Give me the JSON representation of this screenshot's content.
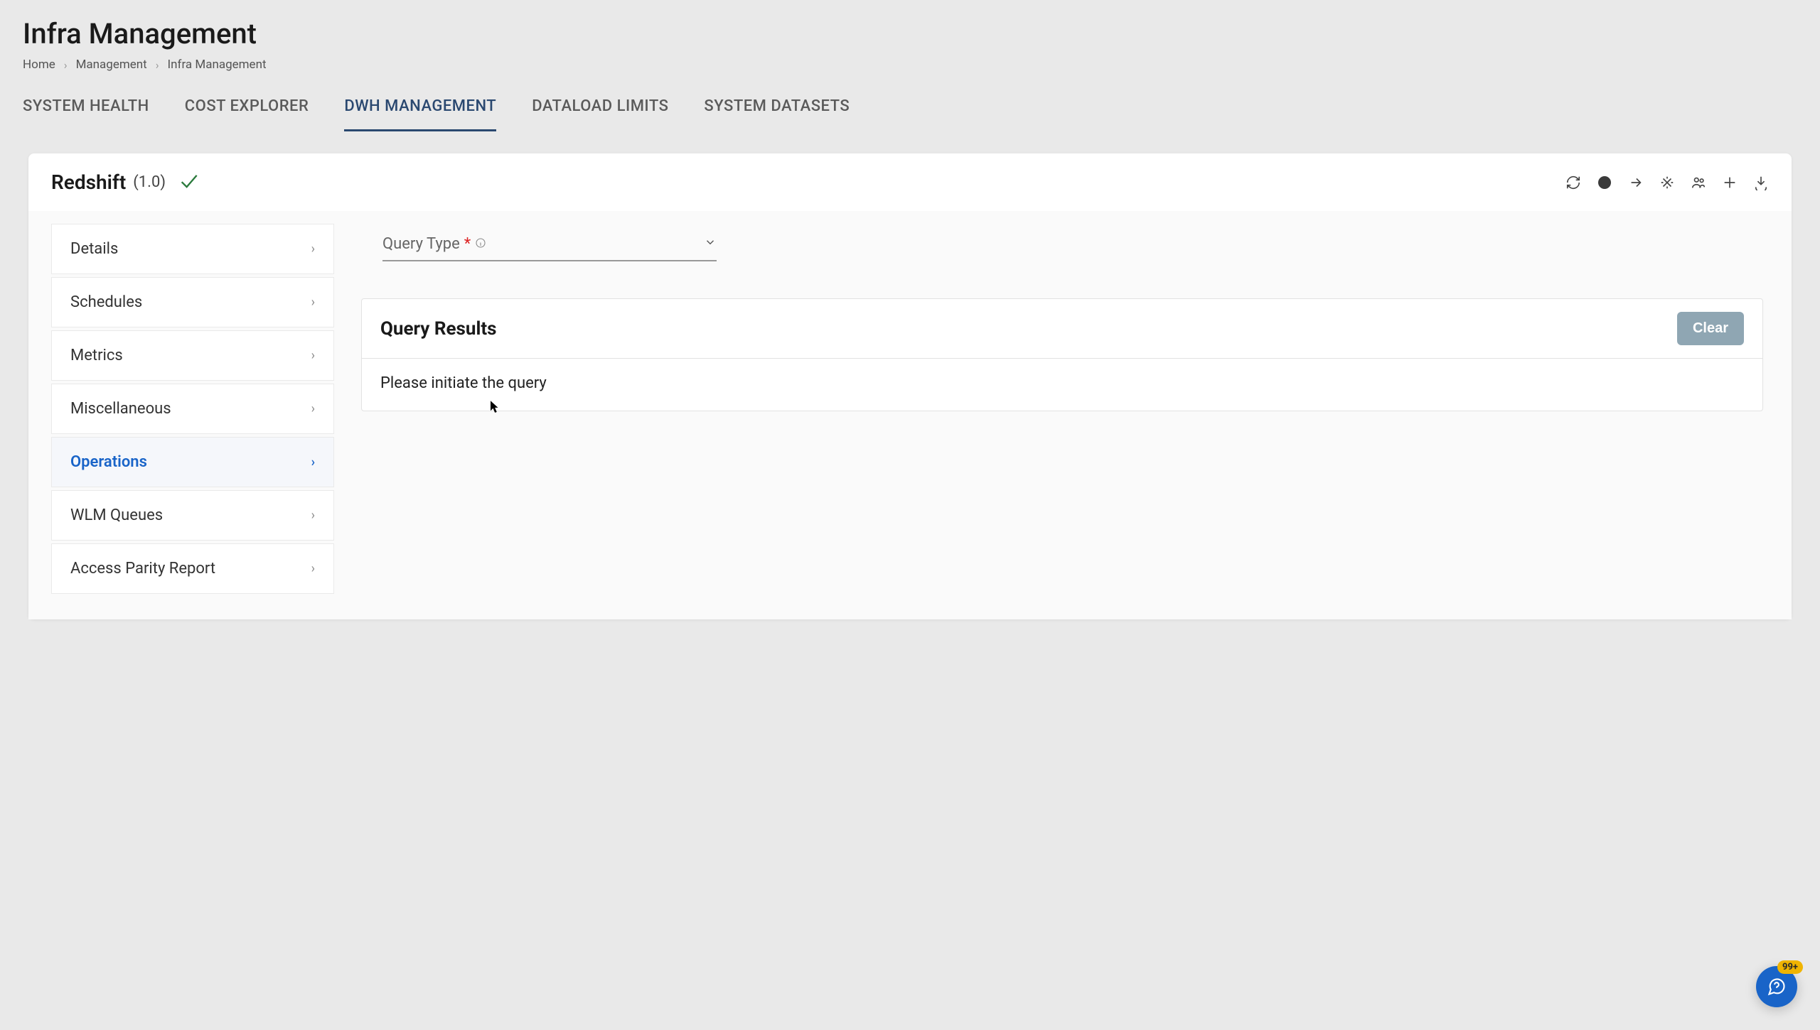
{
  "header": {
    "title": "Infra Management",
    "breadcrumb": [
      "Home",
      "Management",
      "Infra Management"
    ]
  },
  "tabs": [
    {
      "label": "SYSTEM HEALTH",
      "active": false
    },
    {
      "label": "COST EXPLORER",
      "active": false
    },
    {
      "label": "DWH MANAGEMENT",
      "active": true
    },
    {
      "label": "DATALOAD LIMITS",
      "active": false
    },
    {
      "label": "SYSTEM DATASETS",
      "active": false
    }
  ],
  "card": {
    "title": "Redshift",
    "version": "(1.0)"
  },
  "sidebar": {
    "items": [
      {
        "label": "Details",
        "active": false
      },
      {
        "label": "Schedules",
        "active": false
      },
      {
        "label": "Metrics",
        "active": false
      },
      {
        "label": "Miscellaneous",
        "active": false
      },
      {
        "label": "Operations",
        "active": true
      },
      {
        "label": "WLM Queues",
        "active": false
      },
      {
        "label": "Access Parity Report",
        "active": false
      }
    ]
  },
  "panel": {
    "query_type_label": "Query Type",
    "results_title": "Query Results",
    "clear_label": "Clear",
    "empty_message": "Please initiate the query"
  },
  "chat": {
    "badge": "99+"
  }
}
